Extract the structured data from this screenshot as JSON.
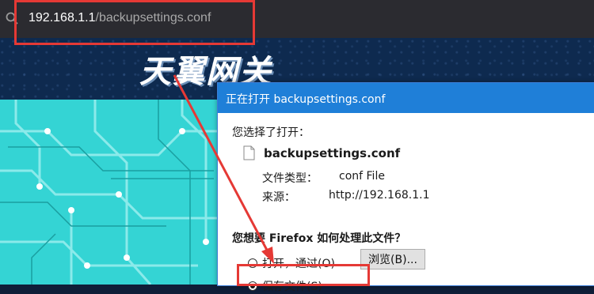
{
  "browser": {
    "url_host": "192.168.1.1",
    "url_path": "/backupsettings.conf"
  },
  "page": {
    "logo_text": "天翼网关"
  },
  "dialog": {
    "title": "正在打开 backupsettings.conf",
    "you_chose": "您选择了打开：",
    "file_name": "backupsettings.conf",
    "type_label": "文件类型：",
    "type_value": "conf File",
    "source_label": "来源：",
    "source_value": "http://192.168.1.1",
    "question": "您想要 Firefox 如何处理此文件？",
    "open_with_label": "打开，通过(O)",
    "browse_label": "浏览(B)...",
    "save_file_label": "保存文件(S)"
  },
  "colors": {
    "annotation": "#e53935",
    "dialog_title_bg": "#1f7fd8",
    "circuit_bg": "#34d4d4"
  }
}
